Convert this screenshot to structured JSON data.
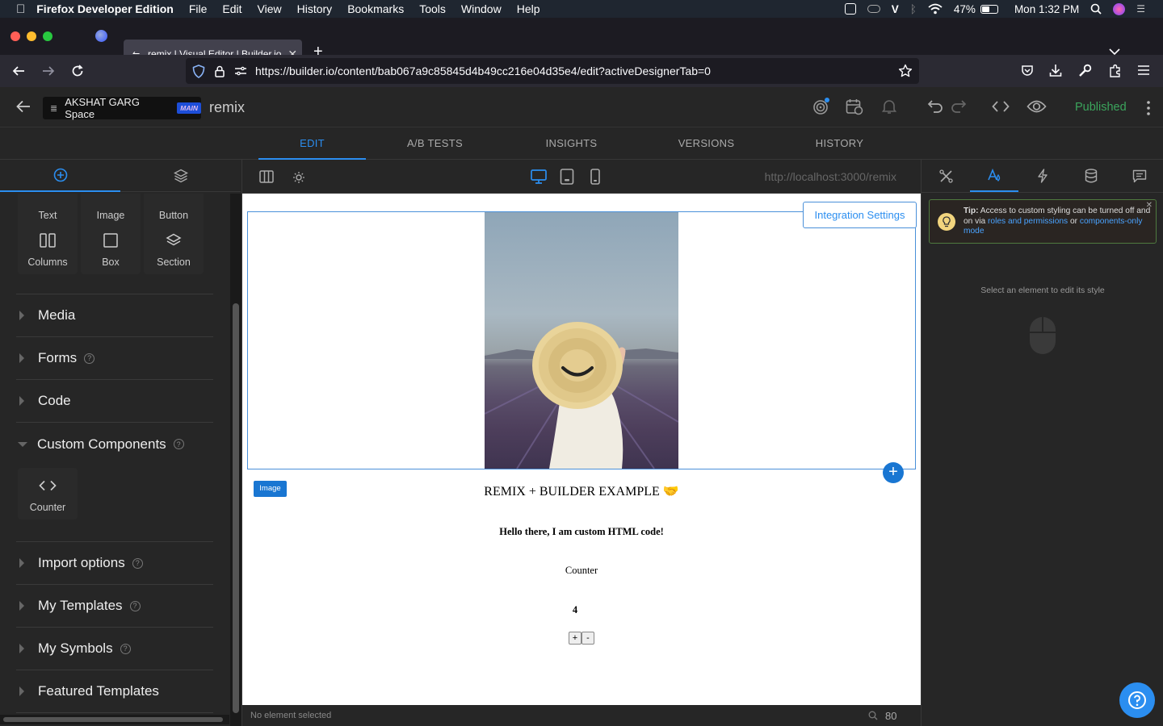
{
  "menubar": {
    "app_name": "Firefox Developer Edition",
    "items": [
      "File",
      "Edit",
      "View",
      "History",
      "Bookmarks",
      "Tools",
      "Window",
      "Help"
    ],
    "battery": "47%",
    "clock": "Mon 1:32 PM"
  },
  "browser": {
    "tab_title": "remix | Visual Editor | Builder.io",
    "url": "https://builder.io/content/bab067a9c85845d4b49cc216e04d35e4/edit?activeDesignerTab=0"
  },
  "builder": {
    "space_name": "AKSHAT GARG Space",
    "space_badge": "MAIN",
    "content_name": "remix",
    "status": "Published",
    "tabs": [
      "EDIT",
      "A/B TESTS",
      "INSIGHTS",
      "VERSIONS",
      "HISTORY"
    ],
    "active_tab": "EDIT"
  },
  "left_panel": {
    "basic_blocks": [
      "Text",
      "Image",
      "Button"
    ],
    "layout_blocks": [
      "Columns",
      "Box",
      "Section"
    ],
    "sections": [
      {
        "label": "Media",
        "help": false
      },
      {
        "label": "Forms",
        "help": true
      },
      {
        "label": "Code",
        "help": false
      }
    ],
    "custom_components": {
      "label": "Custom Components",
      "items": [
        "Counter"
      ]
    },
    "more_sections": [
      {
        "label": "Import options",
        "help": true
      },
      {
        "label": "My Templates",
        "help": true
      },
      {
        "label": "My Symbols",
        "help": true
      },
      {
        "label": "Featured Templates",
        "help": false
      }
    ]
  },
  "canvas_bar": {
    "preview_url": "http://localhost:3000/remix",
    "active_device": "desktop"
  },
  "canvas": {
    "integration_button": "Integration Settings",
    "selected_badge": "Image",
    "heading": "REMIX + BUILDER EXAMPLE 🤝",
    "html_text": "Hello there, I am custom HTML code!",
    "counter_label": "Counter",
    "counter_value": "4",
    "increment": "+",
    "decrement": "-"
  },
  "status_bar": {
    "selection": "No element selected",
    "zoom": "80"
  },
  "right_panel": {
    "tip_label": "Tip:",
    "tip_text": "Access to custom styling can be turned off and on via",
    "tip_link1": "roles and permissions",
    "tip_or": "or",
    "tip_link2": "components-only mode",
    "empty_message": "Select an element to edit its style",
    "active_tab": "style"
  },
  "colors": {
    "accent": "#2b8ef0",
    "published": "#3ba55c",
    "canvas_outline": "#4a90d9"
  }
}
